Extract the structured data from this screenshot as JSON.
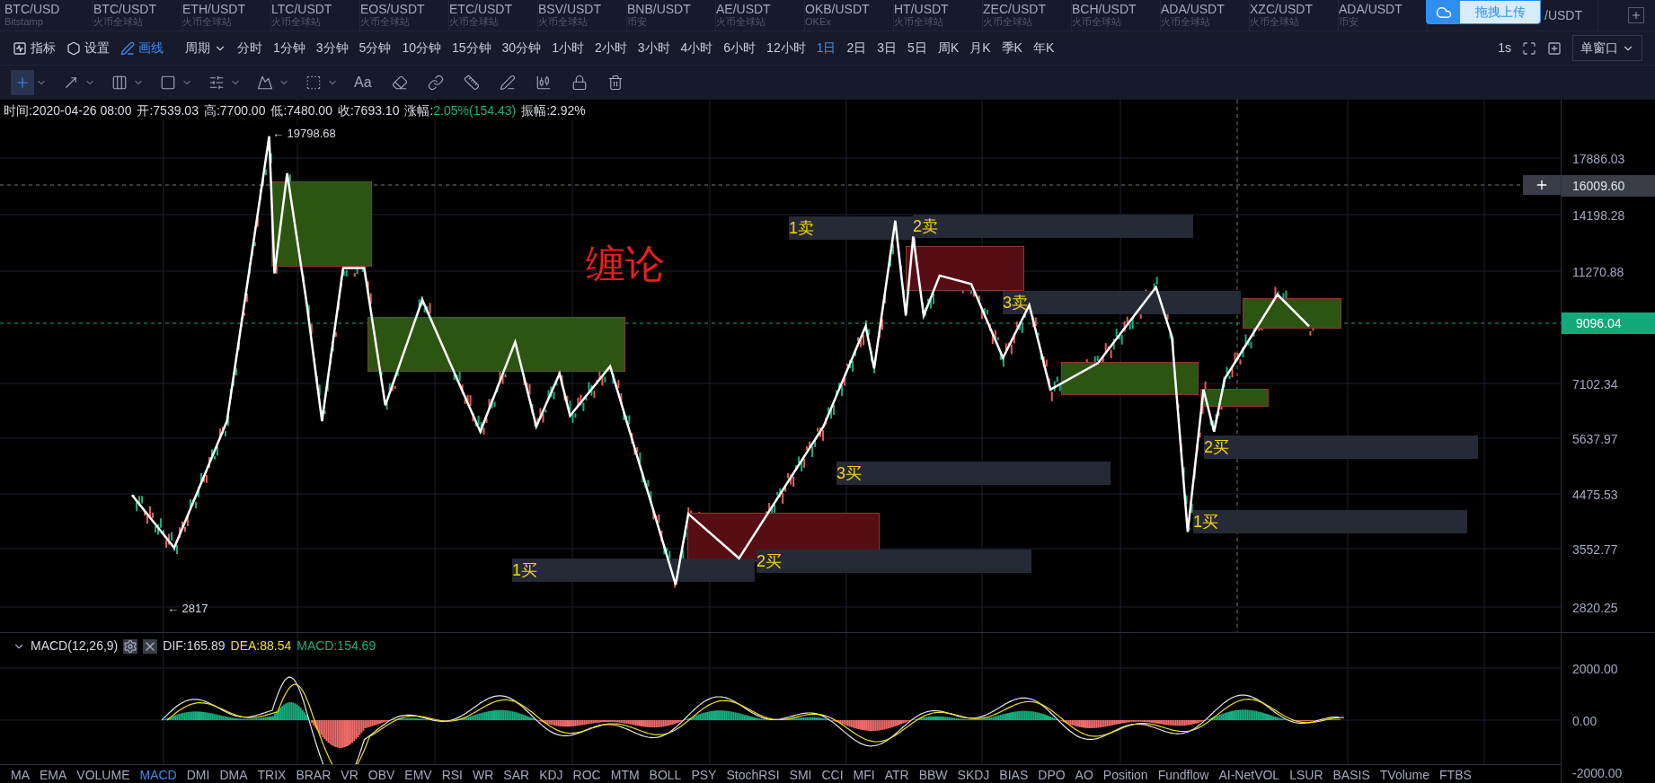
{
  "tickers": [
    {
      "symbol": "BTC/USD",
      "exchange": "Bitstamp"
    },
    {
      "symbol": "BTC/USDT",
      "exchange": "火币全球站"
    },
    {
      "symbol": "ETH/USDT",
      "exchange": "火币全球站"
    },
    {
      "symbol": "LTC/USDT",
      "exchange": "火币全球站"
    },
    {
      "symbol": "EOS/USDT",
      "exchange": "火币全球站"
    },
    {
      "symbol": "ETC/USDT",
      "exchange": "火币全球站"
    },
    {
      "symbol": "BSV/USDT",
      "exchange": "火币全球站"
    },
    {
      "symbol": "BNB/USDT",
      "exchange": "币安"
    },
    {
      "symbol": "AE/USDT",
      "exchange": "火币全球站"
    },
    {
      "symbol": "OKB/USDT",
      "exchange": "OKEx"
    },
    {
      "symbol": "HT/USDT",
      "exchange": "火币全球站"
    },
    {
      "symbol": "ZEC/USDT",
      "exchange": "火币全球站"
    },
    {
      "symbol": "BCH/USDT",
      "exchange": "火币全球站"
    },
    {
      "symbol": "ADA/USDT",
      "exchange": "火币全球站"
    },
    {
      "symbol": "XZC/USDT",
      "exchange": "火币全球站"
    },
    {
      "symbol": "ADA/USDT",
      "exchange": "币安"
    },
    {
      "symbol": "/USDT"
    }
  ],
  "upload_overlay": {
    "label": "拖拽上传"
  },
  "toolbar": {
    "buttons": [
      {
        "kind": "indicator",
        "label": "指标",
        "selected": false
      },
      {
        "kind": "settings",
        "label": "设置",
        "selected": false
      },
      {
        "kind": "draw",
        "label": "画线",
        "selected": true
      }
    ],
    "period_label": "周期",
    "periods": [
      {
        "label": "分时",
        "selected": false
      },
      {
        "label": "1分钟",
        "selected": false
      },
      {
        "label": "3分钟",
        "selected": false
      },
      {
        "label": "5分钟",
        "selected": false
      },
      {
        "label": "10分钟",
        "selected": false
      },
      {
        "label": "15分钟",
        "selected": false
      },
      {
        "label": "30分钟",
        "selected": false
      },
      {
        "label": "1小时",
        "selected": false
      },
      {
        "label": "2小时",
        "selected": false
      },
      {
        "label": "3小时",
        "selected": false
      },
      {
        "label": "4小时",
        "selected": false
      },
      {
        "label": "6小时",
        "selected": false
      },
      {
        "label": "12小时",
        "selected": false
      },
      {
        "label": "1日",
        "selected": true
      },
      {
        "label": "2日",
        "selected": false
      },
      {
        "label": "3日",
        "selected": false
      },
      {
        "label": "5日",
        "selected": false
      },
      {
        "label": "周K",
        "selected": false
      },
      {
        "label": "月K",
        "selected": false
      },
      {
        "label": "季K",
        "selected": false
      },
      {
        "label": "年K",
        "selected": false
      }
    ],
    "refresh": "1s",
    "window_mode": "单窗口"
  },
  "drawing_tools": [
    {
      "kind": "crosshair",
      "selected": true,
      "menu": true
    },
    {
      "kind": "line",
      "selected": false,
      "menu": true
    },
    {
      "kind": "columns",
      "selected": false,
      "menu": true
    },
    {
      "kind": "rectangle",
      "selected": false,
      "menu": true
    },
    {
      "kind": "levels",
      "selected": false,
      "menu": true
    },
    {
      "kind": "wave",
      "selected": false,
      "menu": true
    },
    {
      "kind": "box",
      "selected": false,
      "menu": true
    },
    {
      "kind": "text",
      "label": "Aa",
      "selected": false,
      "menu": false
    },
    {
      "kind": "eraser",
      "selected": false,
      "menu": false
    },
    {
      "kind": "link",
      "selected": false,
      "menu": false
    },
    {
      "kind": "ruler",
      "selected": false,
      "menu": false
    },
    {
      "kind": "pen",
      "selected": false,
      "menu": false
    },
    {
      "kind": "candles",
      "selected": false,
      "menu": false
    },
    {
      "kind": "lock",
      "selected": false,
      "menu": false
    },
    {
      "kind": "trash",
      "selected": false,
      "menu": false
    }
  ],
  "info": {
    "fields": [
      "时间:2020-04-26 08:00",
      "开:7539.03",
      "高:7700.00",
      "低:7480.00",
      "收:7693.10"
    ],
    "change_label": "涨幅:",
    "change_value": "2.05%(154.43)",
    "amplitude": "振幅:2.92%"
  },
  "main_chart": {
    "title": "缠论",
    "high_marker": "← 19798.68",
    "low_marker": "← 2817",
    "y_axis": [
      "17886.03",
      "14198.28",
      "11270.88",
      "7102.34",
      "5637.97",
      "4475.53",
      "3552.77",
      "2820.25"
    ],
    "crosshair_price": "16009.60",
    "last_price": "9096.04",
    "zones": [
      {
        "color": "#2d5512"
      },
      {
        "color": "#2d5512"
      },
      {
        "color": "#560d14"
      },
      {
        "color": "#560d14"
      },
      {
        "color": "#2d5512"
      },
      {
        "color": "#2d5512"
      },
      {
        "color": "#2d5512"
      }
    ],
    "signals": [
      {
        "label": "1卖"
      },
      {
        "label": "2卖"
      },
      {
        "label": "3卖"
      },
      {
        "label": "3买"
      },
      {
        "label": "1买"
      },
      {
        "label": "2买"
      },
      {
        "label": "2买"
      },
      {
        "label": "1买"
      }
    ]
  },
  "macd": {
    "title": "MACD(12,26,9)",
    "dif": "DIF:165.89",
    "dea": "DEA:88.54",
    "macd": "MACD:154.69",
    "y_axis": [
      "2000.00",
      "0.00",
      "-2000.00"
    ]
  },
  "indicator_tabs": [
    {
      "label": "MA",
      "selected": false
    },
    {
      "label": "EMA",
      "selected": false
    },
    {
      "label": "VOLUME",
      "selected": false
    },
    {
      "label": "MACD",
      "selected": true
    },
    {
      "label": "DMI",
      "selected": false
    },
    {
      "label": "DMA",
      "selected": false
    },
    {
      "label": "TRIX",
      "selected": false
    },
    {
      "label": "BRAR",
      "selected": false
    },
    {
      "label": "VR",
      "selected": false
    },
    {
      "label": "OBV",
      "selected": false
    },
    {
      "label": "EMV",
      "selected": false
    },
    {
      "label": "RSI",
      "selected": false
    },
    {
      "label": "WR",
      "selected": false
    },
    {
      "label": "SAR",
      "selected": false
    },
    {
      "label": "KDJ",
      "selected": false
    },
    {
      "label": "ROC",
      "selected": false
    },
    {
      "label": "MTM",
      "selected": false
    },
    {
      "label": "BOLL",
      "selected": false
    },
    {
      "label": "PSY",
      "selected": false
    },
    {
      "label": "StochRSI",
      "selected": false
    },
    {
      "label": "SMI",
      "selected": false
    },
    {
      "label": "CCI",
      "selected": false
    },
    {
      "label": "MFI",
      "selected": false
    },
    {
      "label": "ATR",
      "selected": false
    },
    {
      "label": "BBW",
      "selected": false
    },
    {
      "label": "SKDJ",
      "selected": false
    },
    {
      "label": "BIAS",
      "selected": false
    },
    {
      "label": "DPO",
      "selected": false
    },
    {
      "label": "AO",
      "selected": false
    },
    {
      "label": "Position",
      "selected": false
    },
    {
      "label": "Fundflow",
      "selected": false
    },
    {
      "label": "AI-NetVOL",
      "selected": false
    },
    {
      "label": "LSUR",
      "selected": false
    },
    {
      "label": "BASIS",
      "selected": false
    },
    {
      "label": "TVolume",
      "selected": false
    },
    {
      "label": "FTBS",
      "selected": false
    }
  ]
}
